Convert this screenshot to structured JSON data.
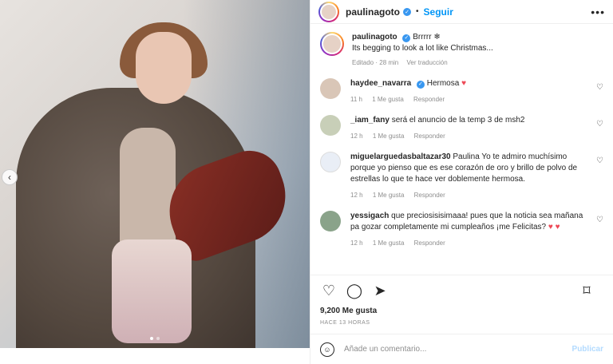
{
  "post": {
    "username": "paulinagoto",
    "follow_label": "Seguir",
    "separator": "•",
    "more_label": "•••",
    "caption_username": "paulinagoto",
    "caption_text_line1": "Brrrrr ❄",
    "caption_text_line2": "Its begging to look a lot like Christmas...",
    "caption_meta": {
      "edited": "Editado · 28 min",
      "translation": "Ver traducción"
    },
    "image_dots": 2,
    "active_dot": 1,
    "nav_left_label": "‹"
  },
  "comments": [
    {
      "username": "haydee_navarra",
      "verified": true,
      "text": "Hermosa",
      "heart_suffix": "♥",
      "time": "11 h",
      "likes": "1 Me gusta",
      "reply": "Responder",
      "avatar_color": "#d9c6b7"
    },
    {
      "username": "_iam_fany",
      "verified": false,
      "text": "será el anuncio de la temp 3 de msh2",
      "heart_suffix": "",
      "time": "12 h",
      "likes": "1 Me gusta",
      "reply": "Responder",
      "avatar_color": "#c8cfb8"
    },
    {
      "username": "miguelarguedasbaltazar30",
      "verified": false,
      "text": "Paulina Yo te admiro muchísimo porque yo pienso que es ese corazón de oro y brillo de polvo de estrellas lo que te hace ver doblemente hermosa.",
      "heart_suffix": "",
      "time": "12 h",
      "likes": "1 Me gusta",
      "reply": "Responder",
      "avatar_color": "#e9eef6"
    },
    {
      "username": "yessigach",
      "verified": false,
      "text": "que preciosisisimaaa! pues que la noticia sea mañana pa gozar completamente mi cumpleaños ¡me Felicitas?",
      "heart_suffix": "♥ ♥",
      "time": "12 h",
      "likes": "1 Me gusta",
      "reply": "Responder",
      "avatar_color": "#8aa38a"
    }
  ],
  "actions": {
    "likes_count": "9,200 Me gusta",
    "time_label": "HACE 13 HORAS"
  },
  "footer": {
    "placeholder": "Añade un comentario...",
    "publish_label": "Publicar"
  },
  "icons": {
    "like": "heart-outline-icon",
    "comment": "comment-icon",
    "share": "paper-plane-icon",
    "save": "bookmark-icon",
    "emoji": "smile-icon",
    "more": "more-horizontal-icon"
  },
  "colors": {
    "accent_blue": "#0095f6",
    "verified_blue": "#3897f0",
    "red_heart": "#ed4956",
    "meta_gray": "#8e8e8e"
  }
}
